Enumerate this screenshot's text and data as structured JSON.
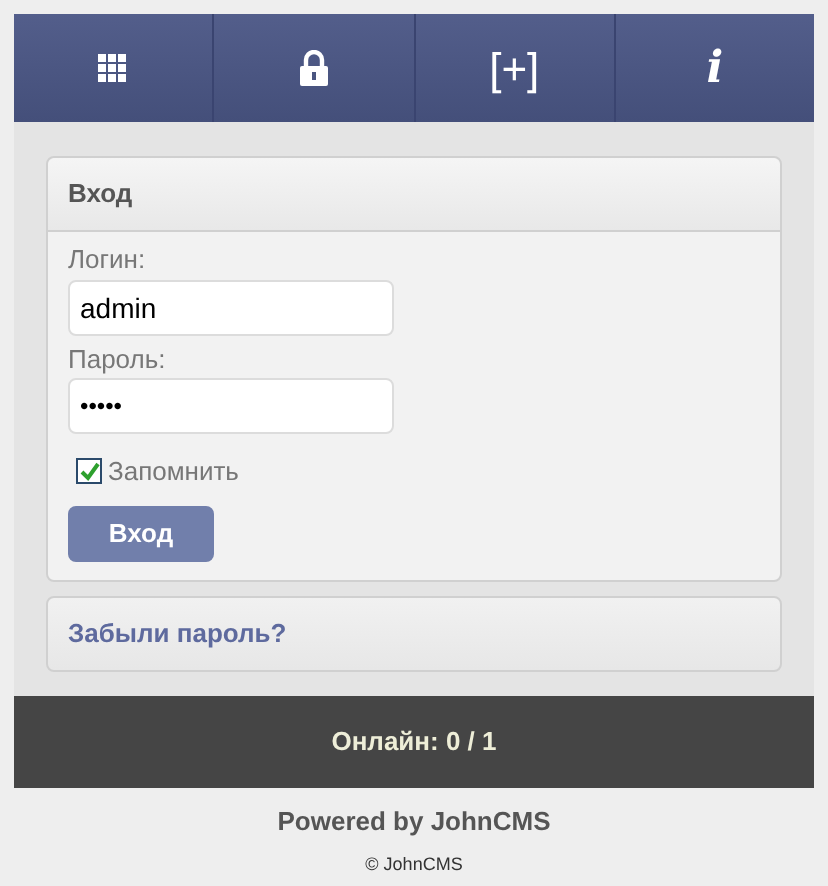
{
  "nav": [
    {
      "kind": "grid"
    },
    {
      "kind": "lock"
    },
    {
      "kind": "text",
      "label": "[+]"
    },
    {
      "kind": "text",
      "label": "i"
    }
  ],
  "login_card": {
    "title": "Вход",
    "login_label": "Логин:",
    "login_value": "admin",
    "password_label": "Пароль:",
    "password_value": "•••••",
    "remember": {
      "label": "Запомнить",
      "checked": true
    },
    "submit": "Вход"
  },
  "forgot_link": "Забыли пароль?",
  "online": "Онлайн: 0 / 1",
  "powered": "Powered by JohnCMS",
  "copyright": "© JohnCMS"
}
